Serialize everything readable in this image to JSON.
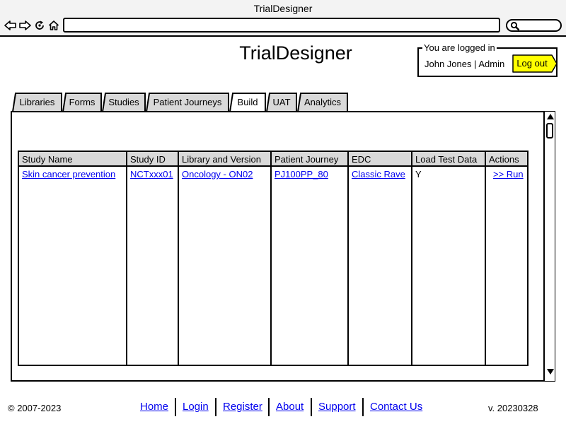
{
  "window": {
    "title": "TrialDesigner"
  },
  "browser": {
    "back_icon": "back-arrow-icon",
    "forward_icon": "forward-arrow-icon",
    "reload_icon": "reload-icon",
    "home_icon": "home-icon",
    "search_icon": "magnifier-icon",
    "url": ""
  },
  "header": {
    "app_title": "TrialDesigner",
    "login": {
      "legend": "You are logged in",
      "user": "John Jones | Admin",
      "logout_label": "Log out"
    }
  },
  "tabs": [
    {
      "label": "Libraries",
      "active": false
    },
    {
      "label": "Forms",
      "active": false
    },
    {
      "label": "Studies",
      "active": false
    },
    {
      "label": "Patient Journeys",
      "active": false
    },
    {
      "label": "Build",
      "active": true
    },
    {
      "label": "UAT",
      "active": false
    },
    {
      "label": "Analytics",
      "active": false
    }
  ],
  "table": {
    "columns": [
      "Study Name",
      "Study ID",
      "Library and Version",
      "Patient Journey",
      "EDC",
      "Load Test Data",
      "Actions"
    ],
    "rows": [
      [
        "Skin cancer prevention",
        "NCTxxx01",
        "Oncology - ON02",
        "PJ100PP_80",
        "Classic Rave",
        "Y",
        ">> Run"
      ]
    ]
  },
  "footer": {
    "copyright": "© 2007-2023",
    "links": [
      "Home",
      "Login",
      "Register",
      "About",
      "Support",
      "Contact Us"
    ],
    "version": "v. 20230328"
  },
  "colors": {
    "tab_inactive": "#d9d9d9",
    "header_row": "#d9d9d9",
    "logout_button": "#ffff00",
    "link": "#0000ee"
  }
}
